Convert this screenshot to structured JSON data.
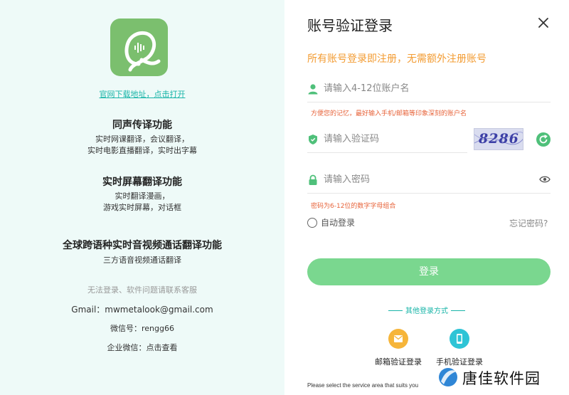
{
  "left": {
    "download_link": "官网下载地址，点击打开",
    "features": [
      {
        "title": "同声传译功能",
        "lines": [
          "实时网课翻译，会议翻译，",
          "实时电影直播翻译，实时出字幕"
        ]
      },
      {
        "title": "实时屏幕翻译功能",
        "lines": [
          "实时翻译漫画，",
          "游戏实时屏幕，对话框"
        ]
      },
      {
        "title": "全球跨语种实时音视频通话翻译功能",
        "lines": [
          "三方语音视频通话翻译"
        ]
      }
    ],
    "support_text": "无法登录、软件问题请联系客服",
    "gmail": "Gmail：mwmetalook@gmail.com",
    "wechat": "微信号：rengg66",
    "enterprise_wechat": "企业微信：点击查看"
  },
  "right": {
    "title": "账号验证登录",
    "notice": "所有账号登录即注册，无需额外注册账号",
    "username": {
      "placeholder": "请输入4-12位账户名",
      "hint": "方便您的记忆，最好输入手机/邮箱等印象深刻的账户名"
    },
    "captcha": {
      "placeholder": "请输入验证码",
      "image_text": "8286"
    },
    "password": {
      "placeholder": "请输入密码",
      "hint": "密码为6-12位的数字字母组合"
    },
    "auto_login": "自动登录",
    "forgot": "忘记密码?",
    "login_button": "登录",
    "other_methods": "其他登录方式",
    "alt_methods": [
      {
        "label": "邮箱验证登录",
        "color": "#f6b53a"
      },
      {
        "label": "手机验证登录",
        "color": "#2ec4d6"
      }
    ],
    "footnote": "Please select the service area that suits you"
  },
  "watermark": {
    "text": "唐佳软件园"
  },
  "colors": {
    "accent_green": "#7ad78f",
    "teal": "#19b5a8",
    "orange": "#f39c33",
    "hint_red": "#e7633a",
    "logo_green": "#7bbf6e"
  }
}
